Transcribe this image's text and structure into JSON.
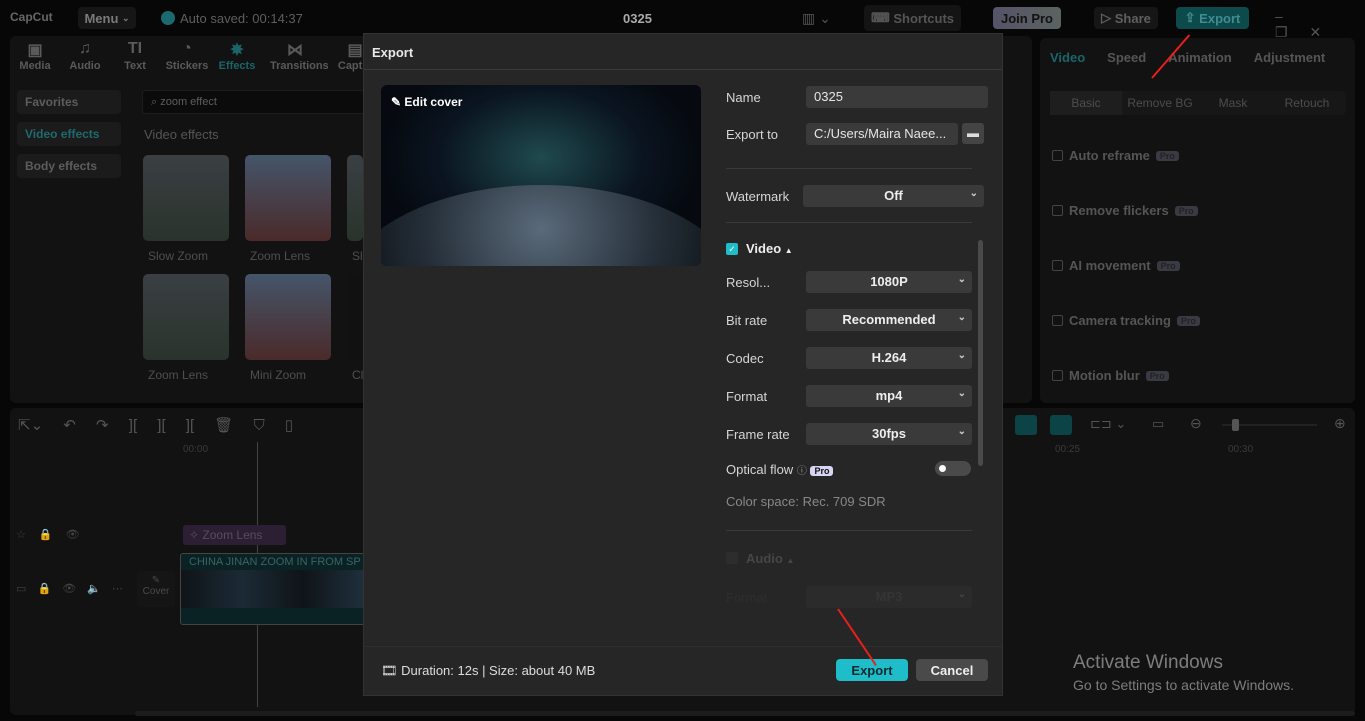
{
  "app": {
    "logo": "CapCut",
    "menu": "Menu",
    "autosave": "Auto saved: 00:14:37",
    "project_title": "0325",
    "shortcuts": "Shortcuts",
    "join_pro": "Join Pro",
    "share": "Share",
    "export": "Export"
  },
  "media_tabs": [
    {
      "label": "Media",
      "icon": "media-icon"
    },
    {
      "label": "Audio",
      "icon": "audio-icon"
    },
    {
      "label": "Text",
      "icon": "text-icon"
    },
    {
      "label": "Stickers",
      "icon": "stickers-icon"
    },
    {
      "label": "Effects",
      "icon": "effects-icon",
      "active": true
    },
    {
      "label": "Transitions",
      "icon": "transitions-icon"
    },
    {
      "label": "Captio",
      "icon": "captions-icon"
    }
  ],
  "sidebar": [
    "Favorites",
    "Video effects",
    "Body effects"
  ],
  "search": {
    "value": "zoom effect"
  },
  "section_title": "Video effects",
  "effects": [
    "Slow Zoom",
    "Zoom Lens",
    "Sl",
    "Zoom Lens",
    "Mini Zoom",
    "Cl"
  ],
  "right_panel": {
    "tabs": [
      "Video",
      "Speed",
      "Animation",
      "Adjustment"
    ],
    "subtabs": [
      "Basic",
      "Remove BG",
      "Mask",
      "Retouch"
    ],
    "options": [
      "Auto reframe",
      "Remove flickers",
      "AI movement",
      "Camera tracking",
      "Motion blur"
    ],
    "pro_badge": "Pro"
  },
  "timeline": {
    "ticks": [
      "00:00",
      "00:25",
      "00:30"
    ],
    "effect_clip": "Zoom Lens",
    "video_clip": "CHINA JINAN ZOOM IN FROM SP",
    "cover": "Cover"
  },
  "dialog": {
    "title": "Export",
    "edit_cover": "Edit cover",
    "name_label": "Name",
    "name_value": "0325",
    "export_to_label": "Export to",
    "export_to_value": "C:/Users/Maira Naee...",
    "watermark_label": "Watermark",
    "watermark_value": "Off",
    "video_section": "Video",
    "video_checked": true,
    "settings": [
      {
        "label": "Resol...",
        "value": "1080P"
      },
      {
        "label": "Bit rate",
        "value": "Recommended"
      },
      {
        "label": "Codec",
        "value": "H.264"
      },
      {
        "label": "Format",
        "value": "mp4"
      },
      {
        "label": "Frame rate",
        "value": "30fps"
      }
    ],
    "optical_flow": "Optical flow",
    "optical_flow_on": false,
    "pro": "Pro",
    "color_space": "Color space: Rec. 709 SDR",
    "audio_section": "Audio",
    "audio_format_label": "Format",
    "audio_format_value": "MP3",
    "footer_info": "Duration: 12s | Size: about 40 MB",
    "export_button": "Export",
    "cancel_button": "Cancel"
  },
  "watermark": {
    "line1": "Activate Windows",
    "line2": "Go to Settings to activate Windows."
  },
  "colors": {
    "accent": "#1fbcc9",
    "annotation_arrow": "#e8201c"
  }
}
